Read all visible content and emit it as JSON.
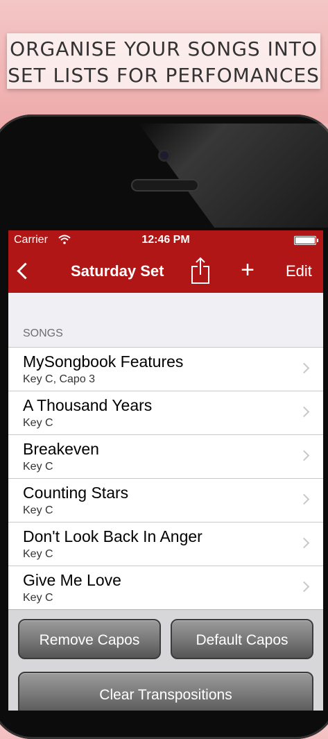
{
  "banner": {
    "line1": "ORGANISE YOUR SONGS INTO",
    "line2": "SET LISTS FOR PERFOMANCES"
  },
  "status_bar": {
    "carrier": "Carrier",
    "time": "12:46 PM",
    "wifi_icon": "wifi-icon",
    "battery_icon": "battery-icon"
  },
  "navbar": {
    "back_icon": "chevron-left-icon",
    "title": "Saturday Set",
    "share_icon": "share-icon",
    "add_label": "+",
    "edit_label": "Edit"
  },
  "section": {
    "header": "SONGS"
  },
  "songs": [
    {
      "title": "MySongbook Features",
      "subtitle": "Key C, Capo 3"
    },
    {
      "title": "A Thousand Years",
      "subtitle": "Key C"
    },
    {
      "title": "Breakeven",
      "subtitle": "Key C"
    },
    {
      "title": "Counting Stars",
      "subtitle": "Key C"
    },
    {
      "title": "Don't Look Back In Anger",
      "subtitle": "Key C"
    },
    {
      "title": "Give Me Love",
      "subtitle": "Key C"
    }
  ],
  "buttons": {
    "remove_capos": "Remove Capos",
    "default_capos": "Default Capos",
    "clear_transpositions": "Clear Transpositions"
  },
  "colors": {
    "accent": "#b11616",
    "background": "#efeff4"
  }
}
